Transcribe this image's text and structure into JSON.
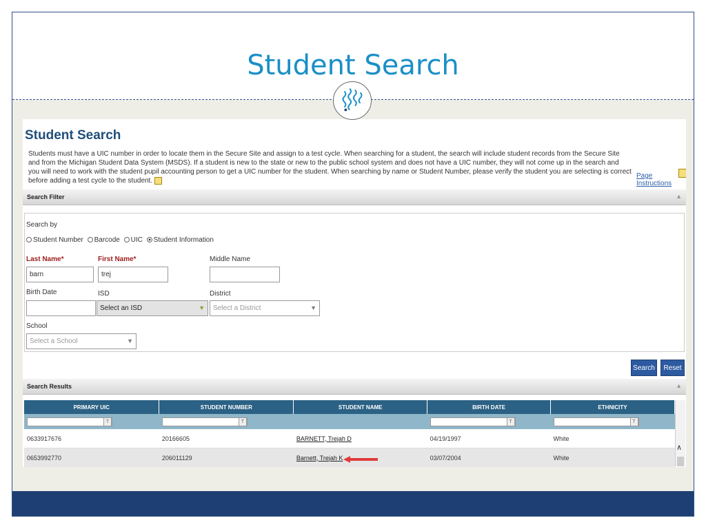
{
  "slide": {
    "title": "Student Search"
  },
  "page": {
    "heading": "Student Search",
    "intro": "Students must have a UIC number in order to locate them in the Secure Site and assign to a test cycle. When searching for a student, the search will include student records from the Secure Site and from the Michigan Student Data System (MSDS). If a student is new to the state or new to the public school system and does not have a UIC number, they will not come up in the search and you will need to work with the student pupil accounting person to get a UIC number for the student. When searching by name or Student Number, please verify the student you are selecting is correct before adding a test cycle to the student.",
    "page_instructions": "Page Instructions"
  },
  "filter": {
    "bar_label": "Search Filter",
    "search_by_label": "Search by",
    "options": [
      "Student Number",
      "Barcode",
      "UIC",
      "Student Information"
    ],
    "selected_option": "Student Information",
    "last_name_label": "Last Name*",
    "last_name_value": "barn",
    "first_name_label": "First Name*",
    "first_name_value": "trej",
    "middle_name_label": "Middle Name",
    "middle_name_value": "",
    "birth_date_label": "Birth Date",
    "birth_date_value": "",
    "isd_label": "ISD",
    "isd_value": "Select an ISD",
    "district_label": "District",
    "district_placeholder": "Select a District",
    "school_label": "School",
    "school_placeholder": "Select a School"
  },
  "buttons": {
    "search": "Search",
    "reset": "Reset"
  },
  "results": {
    "bar_label": "Search Results",
    "columns": [
      "PRIMARY UIC",
      "STUDENT NUMBER",
      "STUDENT NAME",
      "BIRTH DATE",
      "ETHNICITY"
    ],
    "rows": [
      {
        "uic": "0633917676",
        "student_number": "20166605",
        "name": "BARNETT, Trejah D",
        "birth_date": "04/19/1997",
        "ethnicity": "White"
      },
      {
        "uic": "0653992770",
        "student_number": "206011129",
        "name": "Barnett, Trejah K",
        "birth_date": "03/07/2004",
        "ethnicity": "White"
      }
    ]
  },
  "colors": {
    "title": "#1a8fc7",
    "header_bg": "#2b6184",
    "button": "#2d5aa0",
    "arrow": "#e03a3a",
    "footer": "#1e3f73"
  }
}
